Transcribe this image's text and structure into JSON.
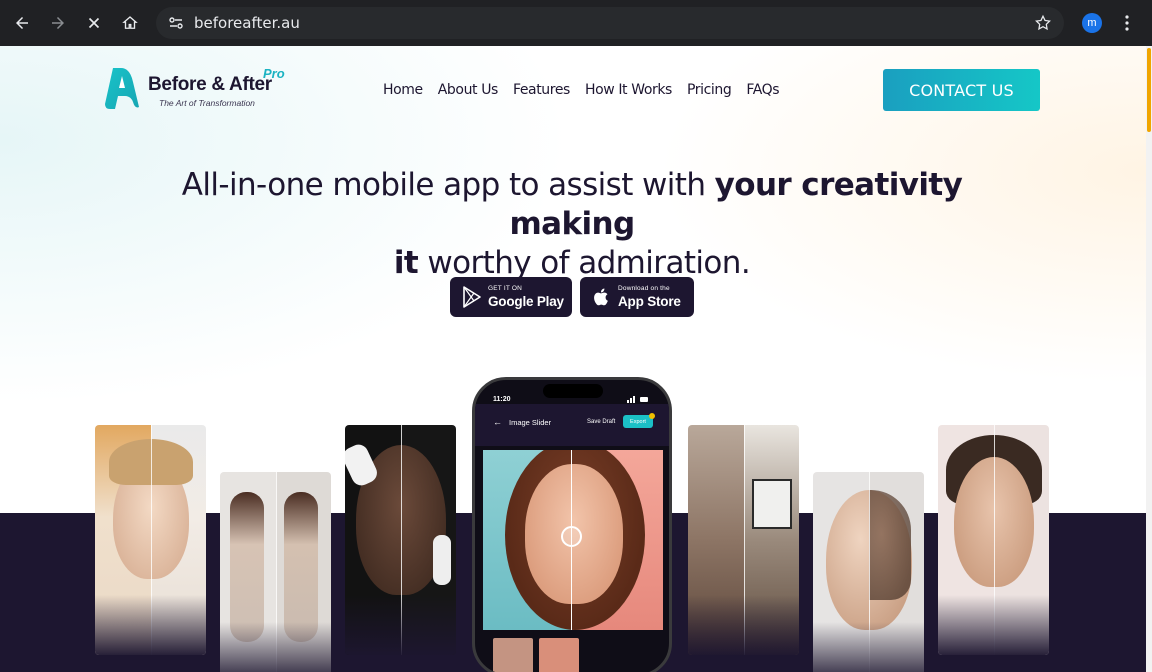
{
  "browser": {
    "url": "beforeafter.au",
    "profile_initial": "m"
  },
  "site": {
    "brand_name": "Before & After",
    "brand_pro": "Pro",
    "brand_tagline": "The Art of Transformation",
    "nav": [
      "Home",
      "About Us",
      "Features",
      "How It Works",
      "Pricing",
      "FAQs"
    ],
    "contact_label": "CONTACT US"
  },
  "hero": {
    "title_plain_1": "All-in-one mobile app to assist with ",
    "title_bold_1": "your creativity making",
    "title_bold_2": "it",
    "title_plain_2": " worthy of admiration."
  },
  "stores": {
    "google_small": "GET IT ON",
    "google_big": "Google Play",
    "apple_small": "Download on the",
    "apple_big": "App Store"
  },
  "phone": {
    "time": "11:20",
    "screen_title": "Image Slider",
    "save_label": "Save Draft",
    "export_label": "Export"
  },
  "colors": {
    "brand_dark": "#1d1630",
    "brand_teal": "#15c7c7",
    "chrome_bg": "#202124"
  }
}
